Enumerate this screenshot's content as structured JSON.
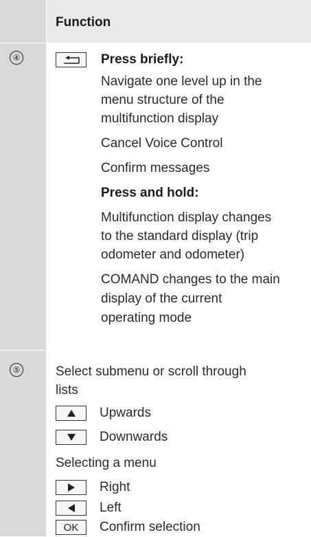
{
  "table": {
    "header": "Function",
    "rows": [
      {
        "number": "④",
        "key_icon": "back-key-icon",
        "press_briefly_label": "Press briefly:",
        "brief_lines": [
          "Navigate one level up in the",
          "menu structure of the",
          "multifunction display",
          "Cancel Voice Control",
          "Confirm messages"
        ],
        "press_hold_label": "Press and hold:",
        "hold_lines": [
          "Multifunction display changes",
          "to the standard display (trip",
          "odometer and odometer)",
          "COMAND changes to the main",
          "display of the current",
          "operating mode"
        ]
      },
      {
        "number": "⑤",
        "intro_lines": [
          "Select submenu or scroll through",
          "lists"
        ],
        "keys_scroll": [
          {
            "icon": "up-arrow-key-icon",
            "label": "Upwards"
          },
          {
            "icon": "down-arrow-key-icon",
            "label": "Downwards"
          }
        ],
        "menu_label": "Selecting a menu",
        "keys_menu": [
          {
            "icon": "right-arrow-key-icon",
            "label": "Right"
          },
          {
            "icon": "left-arrow-key-icon",
            "label": "Left"
          },
          {
            "icon": "ok-key-icon",
            "key_text": "OK",
            "label": "Confirm selection"
          }
        ]
      }
    ]
  }
}
